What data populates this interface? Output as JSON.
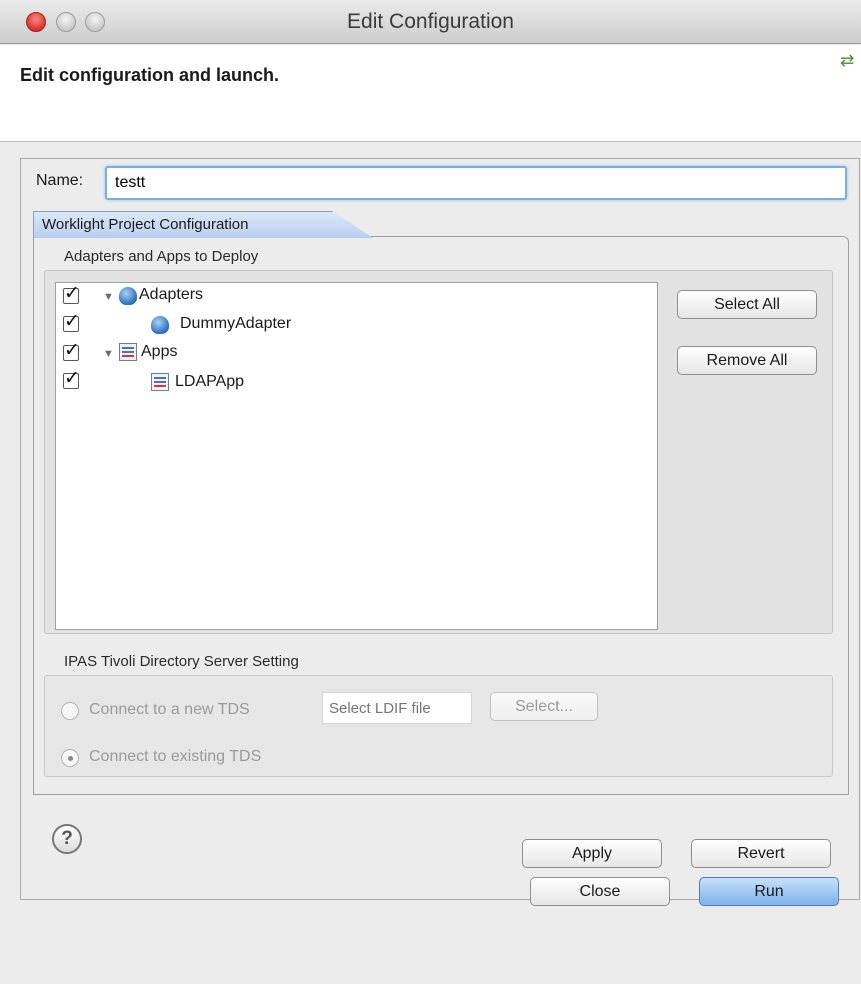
{
  "window": {
    "title": "Edit Configuration"
  },
  "header": {
    "text": "Edit configuration and launch."
  },
  "name_field": {
    "label": "Name:",
    "value": "testt"
  },
  "tab": {
    "label": "Worklight Project Configuration"
  },
  "deploy_group": {
    "label": "Adapters and Apps to Deploy",
    "tree": [
      {
        "label": "Adapters",
        "checked": true,
        "expanded": true,
        "icon": "adapter-icon"
      },
      {
        "label": "DummyAdapter",
        "checked": true,
        "icon": "adapter-icon"
      },
      {
        "label": "Apps",
        "checked": true,
        "expanded": true,
        "icon": "apps-icon"
      },
      {
        "label": "LDAPApp",
        "checked": true,
        "icon": "apps-icon"
      }
    ],
    "select_all": "Select All",
    "remove_all": "Remove All"
  },
  "tds_group": {
    "label": "IPAS Tivoli Directory Server Setting",
    "option_new": "Connect to a new TDS",
    "ldif_placeholder": "Select LDIF file",
    "select_button": "Select...",
    "option_existing": "Connect to existing TDS"
  },
  "buttons": {
    "apply": "Apply",
    "revert": "Revert",
    "close": "Close",
    "run": "Run"
  },
  "help": {
    "glyph": "?"
  }
}
